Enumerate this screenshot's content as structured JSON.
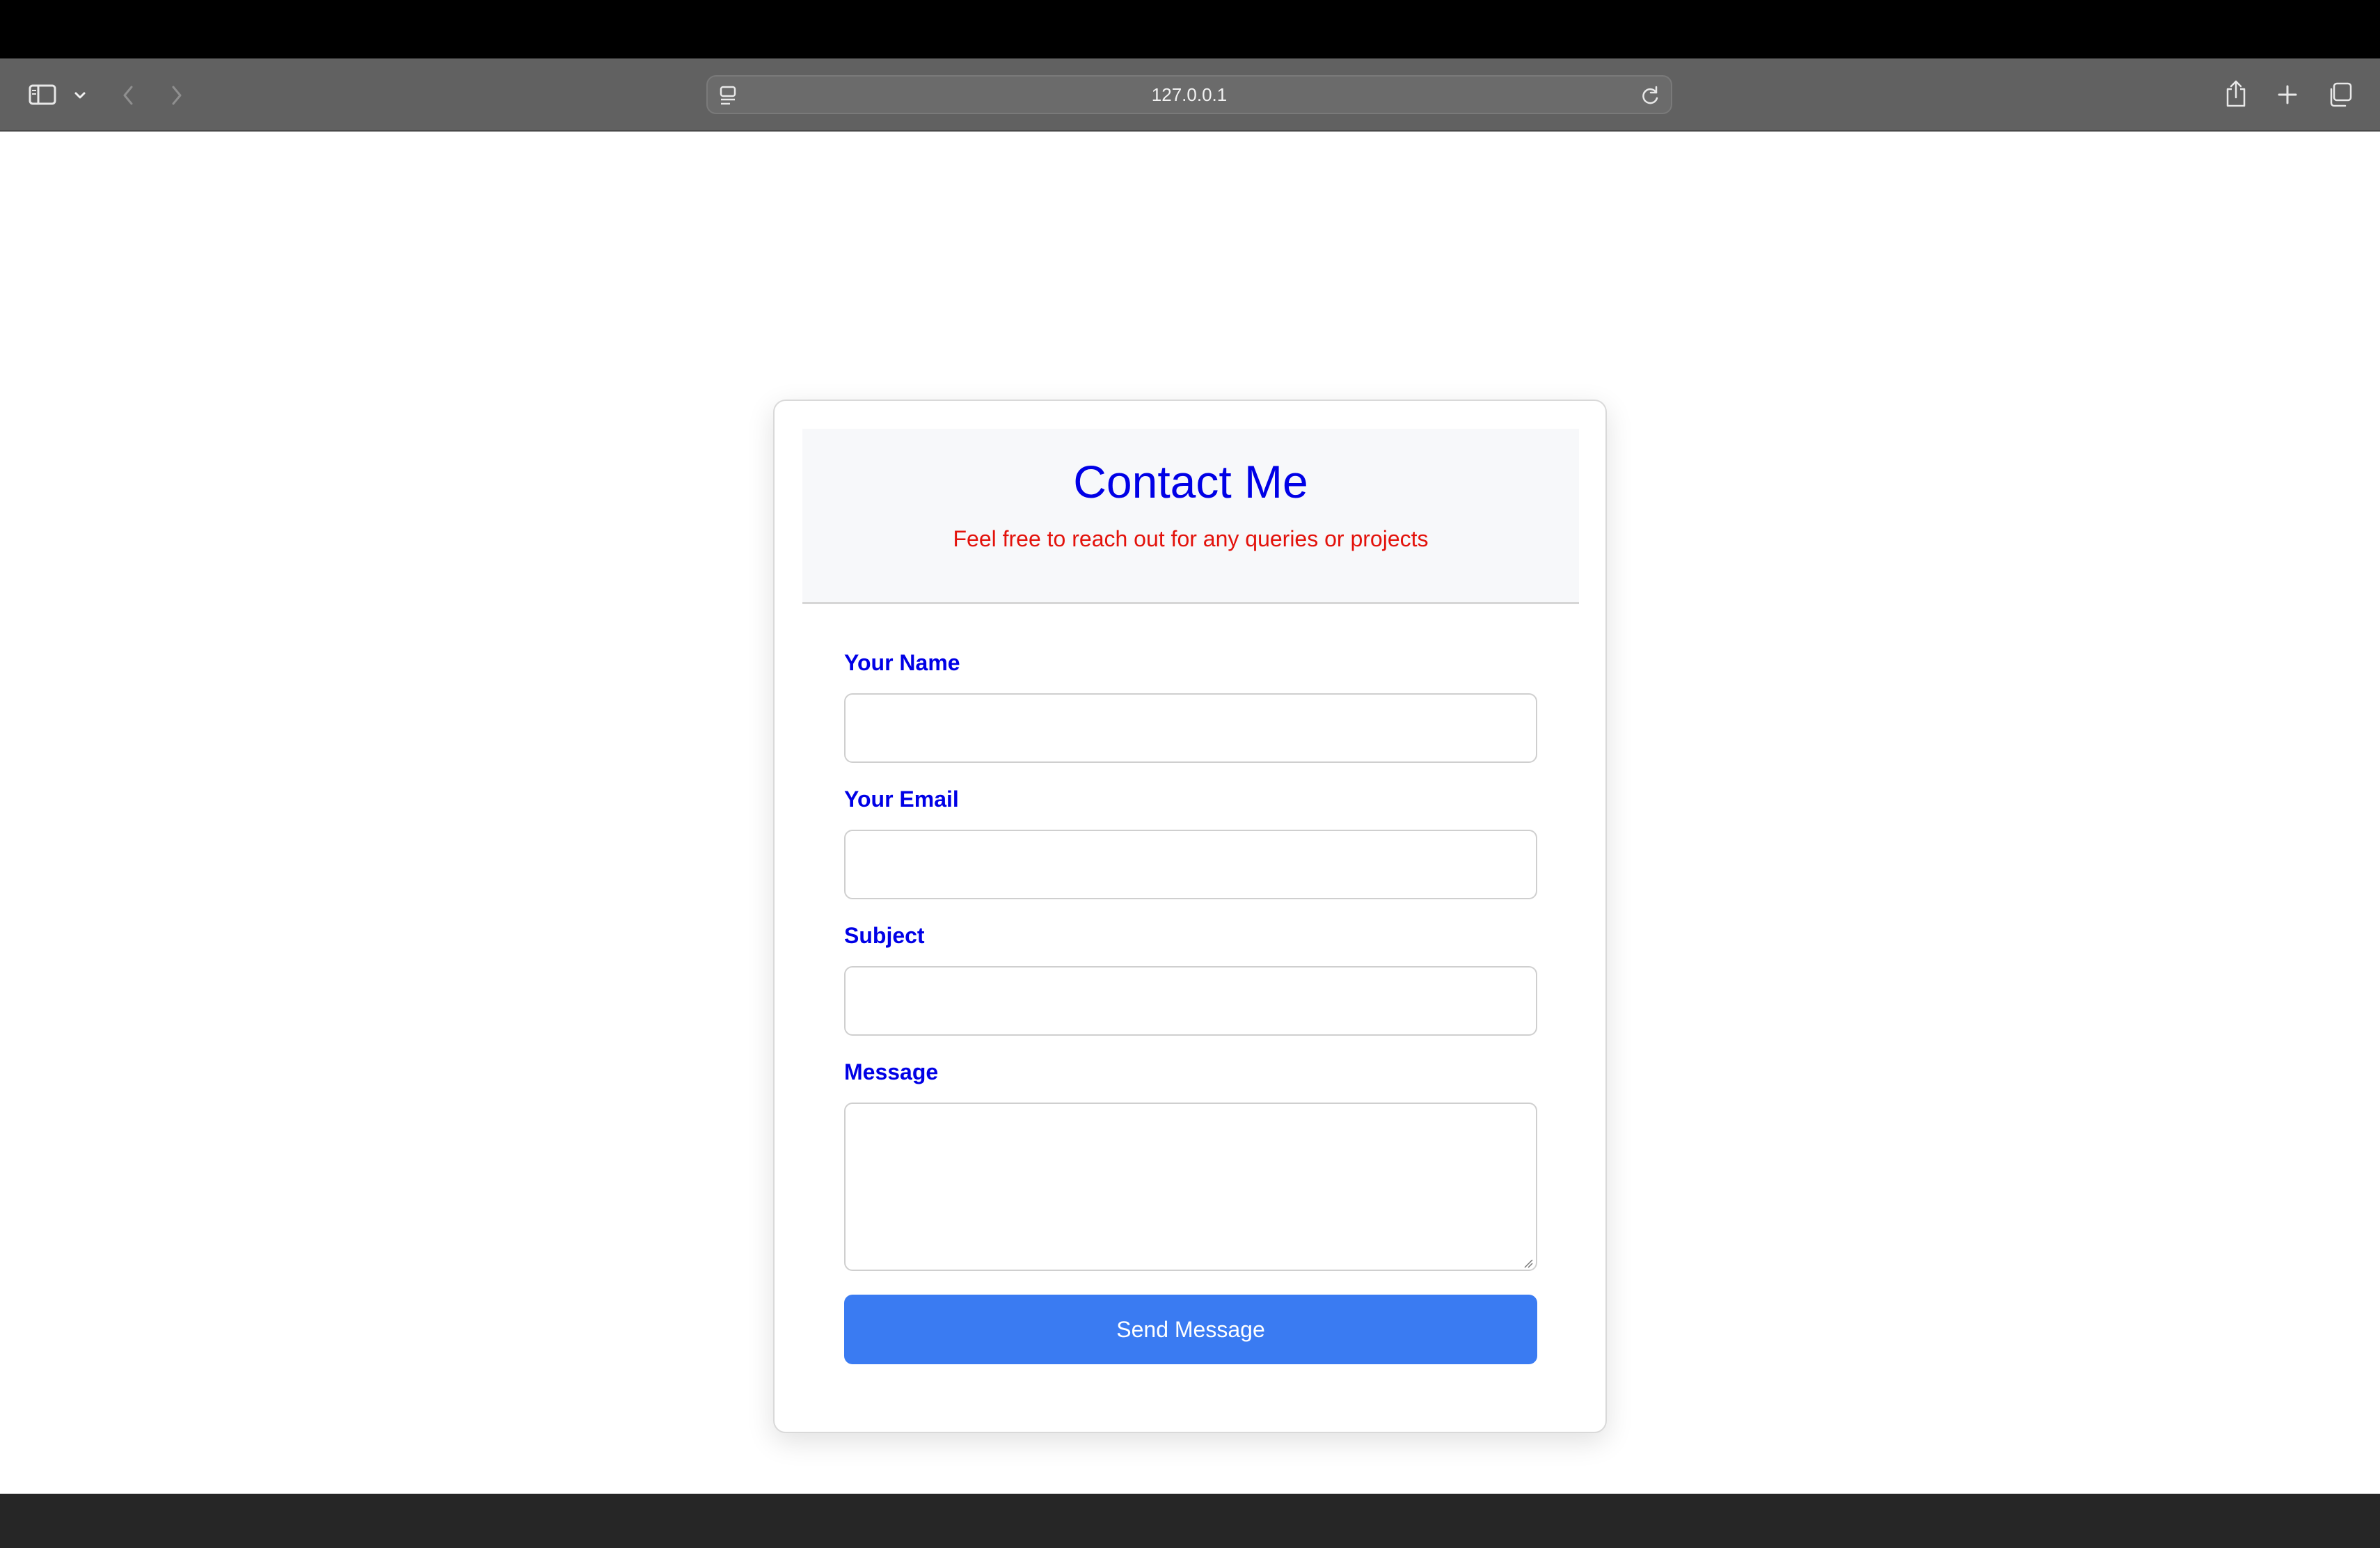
{
  "browser": {
    "url": "127.0.0.1",
    "icons": {
      "sidebar": "sidebar-icon",
      "sidebar_menu": "chevron-down-icon",
      "back": "chevron-left-icon",
      "forward": "chevron-right-icon",
      "site_settings": "page-settings-icon",
      "reload": "reload-icon",
      "share": "share-icon",
      "new_tab": "plus-icon",
      "tab_overview": "tabs-overview-icon"
    }
  },
  "contact": {
    "title": "Contact Me",
    "subtitle": "Feel free to reach out for any queries or projects",
    "fields": {
      "name": {
        "label": "Your Name",
        "value": ""
      },
      "email": {
        "label": "Your Email",
        "value": ""
      },
      "subject": {
        "label": "Subject",
        "value": ""
      },
      "message": {
        "label": "Message",
        "value": ""
      }
    },
    "submit_label": "Send Message"
  },
  "colors": {
    "title": "#0000e6",
    "label": "#0000e6",
    "subtitle": "#e3120b",
    "button": "#3a7bf2",
    "header_bg": "#f7f8fa"
  }
}
